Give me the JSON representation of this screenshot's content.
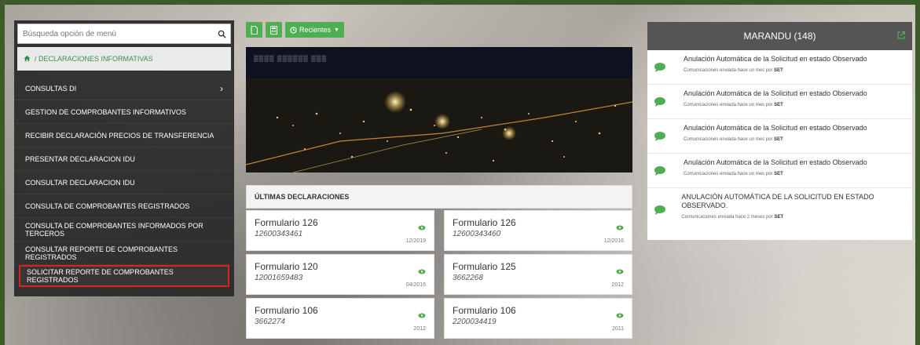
{
  "sidebar": {
    "search_placeholder": "Búsqueda opción de menú",
    "breadcrumb": "/ DECLARACIONES INFORMATIVAS",
    "items": [
      {
        "label": "CONSULTAS DI",
        "arrow": "›"
      },
      {
        "label": "GESTION DE COMPROBANTES INFORMATIVOS"
      },
      {
        "label": "RECIBIR DECLARACIÓN PRECIOS DE TRANSFERENCIA"
      },
      {
        "label": "PRESENTAR DECLARACION IDU"
      },
      {
        "label": "CONSULTAR DECLARACION IDU"
      },
      {
        "label": "CONSULTA DE COMPROBANTES REGISTRADOS"
      },
      {
        "label": "CONSULTA DE COMPROBANTES INFORMADOS POR TERCEROS"
      },
      {
        "label": "CONSULTAR REPORTE DE COMPROBANTES REGISTRADOS"
      },
      {
        "label": "SOLICITAR REPORTE DE COMPROBANTES REGISTRADOS"
      }
    ]
  },
  "toolbar": {
    "recientes_label": "Recientes"
  },
  "decl_header": "ÚLTIMAS DECLARACIONES",
  "declarations": [
    {
      "title": "Formulario 126",
      "number": "12600343461",
      "date": "12/2019"
    },
    {
      "title": "Formulario 126",
      "number": "12600343460",
      "date": "12/2016"
    },
    {
      "title": "Formulario 120",
      "number": "12001659483",
      "date": "04/2016"
    },
    {
      "title": "Formulario 125",
      "number": "3662268",
      "date": "2012"
    },
    {
      "title": "Formulario 106",
      "number": "3662274",
      "date": "2012"
    },
    {
      "title": "Formulario 106",
      "number": "2200034419",
      "date": "2011"
    }
  ],
  "panel": {
    "title": "MARANDU (148)",
    "notifications": [
      {
        "title": "Anulación Automática de la Solicitud en estado Observado",
        "sub": "Comunicaciones enviada hace un mes por",
        "sender": "SET"
      },
      {
        "title": "Anulación Automática de la Solicitud en estado Observado",
        "sub": "Comunicaciones enviada hace un mes por",
        "sender": "SET"
      },
      {
        "title": "Anulación Automática de la Solicitud en estado Observado",
        "sub": "Comunicaciones enviada hace un mes por",
        "sender": "SET"
      },
      {
        "title": "Anulación Automática de la Solicitud en estado Observado",
        "sub": "Comunicaciones enviada hace un mes por",
        "sender": "SET"
      },
      {
        "title": "ANULACIÓN AUTOMÁTICA DE LA SOLICITUD EN ESTADO OBSERVADO.",
        "sub": "Comunicaciones enviada hace 2 meses por",
        "sender": "SET"
      }
    ]
  },
  "watermark": "Ambiente de",
  "colors": {
    "accent": "#4fae52",
    "highlight": "#e0201c",
    "panel_header": "#555555"
  }
}
